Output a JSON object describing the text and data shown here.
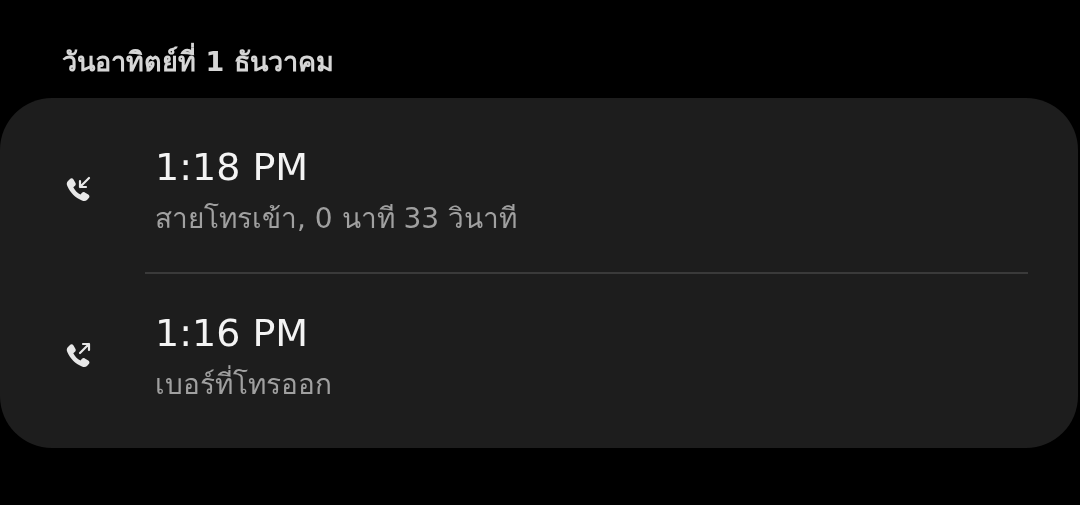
{
  "date_header": "วันอาทิตย์ที่ 1 ธันวาคม",
  "calls": [
    {
      "kind": "incoming",
      "time": "1:18 PM",
      "detail": "สายโทรเข้า, 0 นาที 33 วินาที"
    },
    {
      "kind": "outgoing",
      "time": "1:16 PM",
      "detail": "เบอร์ที่โทรออก"
    }
  ]
}
